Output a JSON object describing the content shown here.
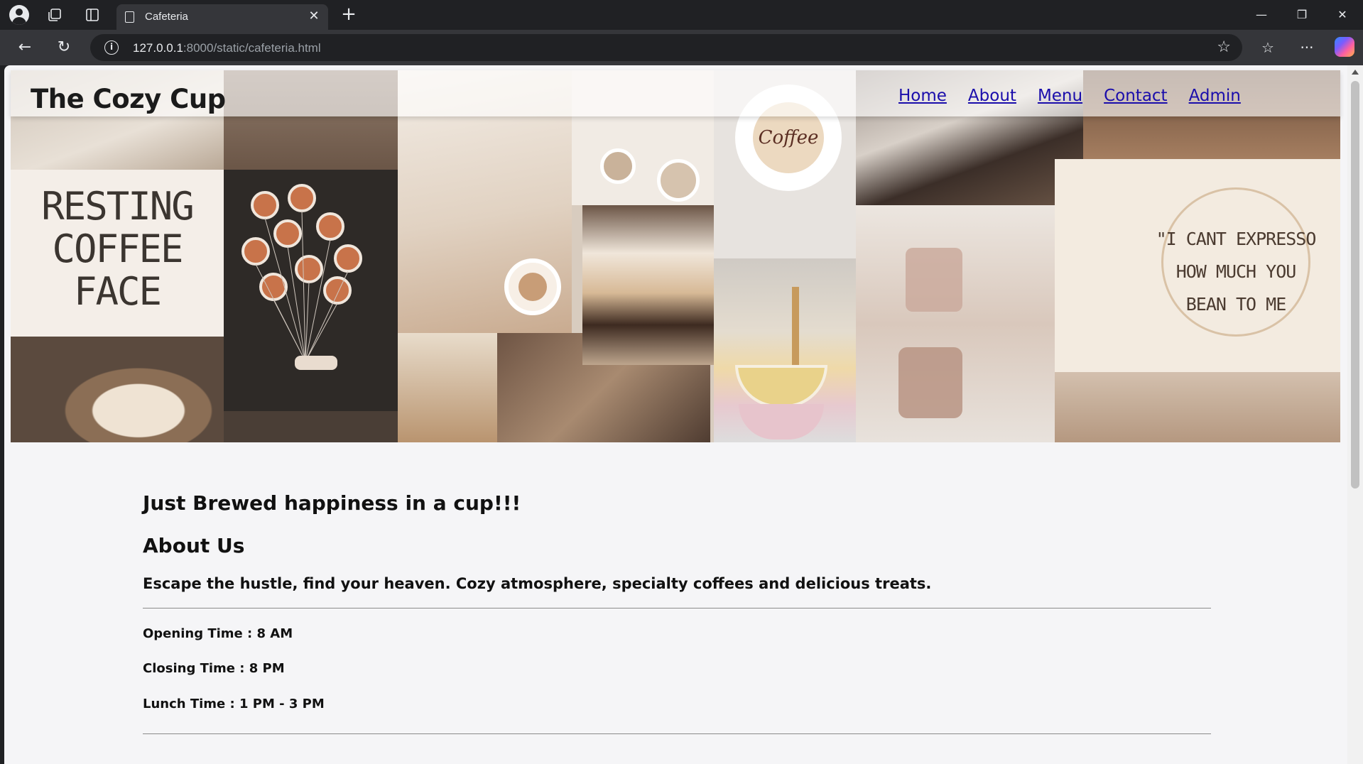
{
  "browser": {
    "tab_title": "Cafeteria",
    "url_host": "127.0.0.1",
    "url_path": ":8000/static/cafeteria.html"
  },
  "site": {
    "brand": "The Cozy Cup",
    "nav": [
      "Home",
      "About",
      "Menu",
      "Contact",
      "Admin"
    ],
    "link_color": "#1a0dab"
  },
  "hero": {
    "texts": {
      "resting": [
        "RESTING",
        "COFFEE",
        "FACE"
      ],
      "cup_text": "Coffee",
      "expresso": [
        "\"I CANT EXPRESSO",
        "HOW MUCH YOU",
        "BEAN TO ME"
      ]
    }
  },
  "content": {
    "tagline": "Just Brewed happiness in a cup!!!",
    "about_heading": "About Us",
    "about_text": "Escape the hustle, find your heaven. Cozy atmosphere, specialty coffees and delicious treats.",
    "opening": "Opening Time : 8 AM",
    "closing": "Closing Time : 8 PM",
    "lunch": "Lunch Time : 1 PM - 3 PM"
  }
}
